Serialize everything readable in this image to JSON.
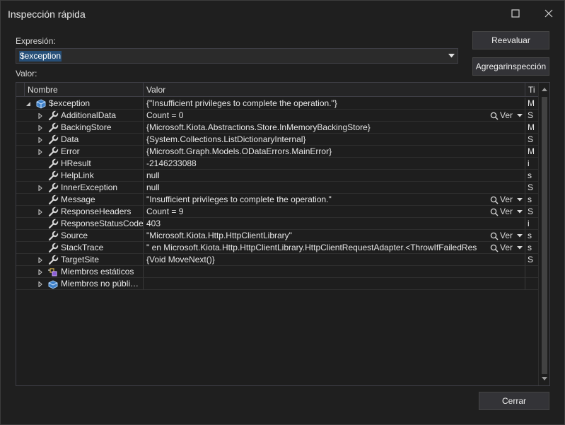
{
  "dialog": {
    "title": "Inspección rápida"
  },
  "expression": {
    "label": "Expresión:",
    "value": "$exception"
  },
  "buttons": {
    "reevaluate": "Reevaluar",
    "add_watch": "Agregarinspección",
    "close": "Cerrar"
  },
  "value_label": "Valor:",
  "grid": {
    "columns": {
      "name": "Nombre",
      "value": "Valor",
      "type": "Ti"
    },
    "view_label": "Ver",
    "rows": [
      {
        "name": "$exception",
        "value": "{\"Insufficient privileges to complete the operation.\"}",
        "type": "M",
        "icon": "object-icon",
        "expander": "expanded",
        "view": false
      },
      {
        "name": "AdditionalData",
        "value": "Count = 0",
        "type": "S",
        "icon": "property-wrench-icon",
        "expander": "collapsed",
        "view": true
      },
      {
        "name": "BackingStore",
        "value": "{Microsoft.Kiota.Abstractions.Store.InMemoryBackingStore}",
        "type": "M",
        "icon": "property-wrench-icon",
        "expander": "collapsed",
        "view": false
      },
      {
        "name": "Data",
        "value": "{System.Collections.ListDictionaryInternal}",
        "type": "S",
        "icon": "property-wrench-icon",
        "expander": "collapsed",
        "view": false
      },
      {
        "name": "Error",
        "value": "{Microsoft.Graph.Models.ODataErrors.MainError}",
        "type": "M",
        "icon": "property-wrench-icon",
        "expander": "collapsed",
        "view": false
      },
      {
        "name": "HResult",
        "value": "-2146233088",
        "type": "i",
        "icon": "property-wrench-icon",
        "expander": "none",
        "view": false
      },
      {
        "name": "HelpLink",
        "value": "null",
        "type": "s",
        "icon": "property-wrench-icon",
        "expander": "none",
        "view": false
      },
      {
        "name": "InnerException",
        "value": "null",
        "type": "S",
        "icon": "property-wrench-icon",
        "expander": "collapsed",
        "view": false
      },
      {
        "name": "Message",
        "value": "\"Insufficient privileges to complete the operation.\"",
        "type": "s",
        "icon": "property-wrench-icon",
        "expander": "none",
        "view": true
      },
      {
        "name": "ResponseHeaders",
        "value": "Count = 9",
        "type": "S",
        "icon": "property-wrench-icon",
        "expander": "collapsed",
        "view": true
      },
      {
        "name": "ResponseStatusCode",
        "value": "403",
        "type": "i",
        "icon": "property-wrench-icon",
        "expander": "none",
        "view": false
      },
      {
        "name": "Source",
        "value": "\"Microsoft.Kiota.Http.HttpClientLibrary\"",
        "type": "s",
        "icon": "property-wrench-icon",
        "expander": "none",
        "view": true
      },
      {
        "name": "StackTrace",
        "value": "\"   en Microsoft.Kiota.Http.HttpClientLibrary.HttpClientRequestAdapter.<ThrowIfFailedRes",
        "type": "s",
        "icon": "property-wrench-icon",
        "expander": "none",
        "view": true
      },
      {
        "name": "TargetSite",
        "value": "{Void MoveNext()}",
        "type": "S",
        "icon": "property-wrench-icon",
        "expander": "collapsed",
        "view": false
      },
      {
        "name": "Miembros estáticos",
        "value": "",
        "type": "",
        "icon": "static-members-icon",
        "expander": "collapsed",
        "view": false
      },
      {
        "name": "Miembros no públi…",
        "value": "",
        "type": "",
        "icon": "non-public-members-icon",
        "expander": "collapsed",
        "view": false
      }
    ]
  }
}
